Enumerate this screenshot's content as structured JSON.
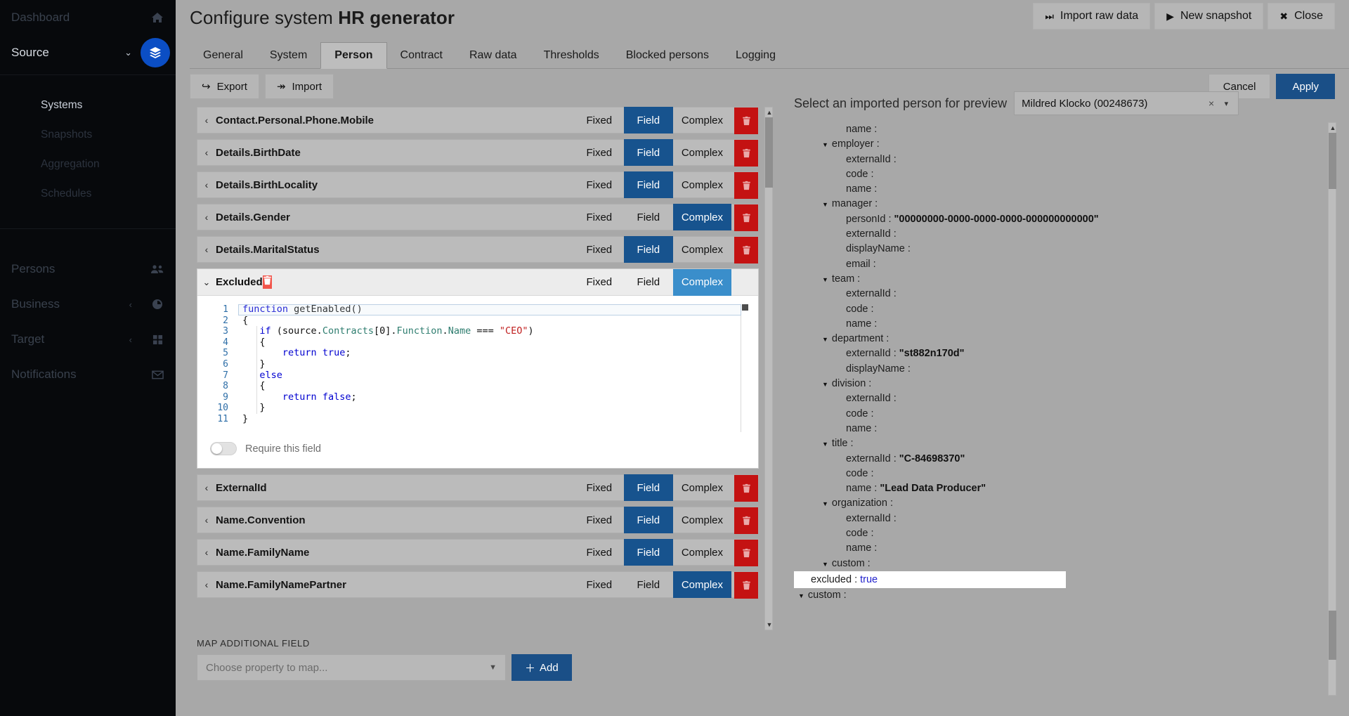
{
  "sidebar": {
    "items": [
      {
        "label": "Dashboard",
        "icon": "home-icon",
        "active": false,
        "chevron": null,
        "highlight": false
      },
      {
        "label": "Source",
        "icon": "layers-icon",
        "active": true,
        "chevron": "⌄",
        "highlight": true
      }
    ],
    "sub_items": [
      {
        "label": "Systems",
        "active": true
      },
      {
        "label": "Snapshots",
        "active": false
      },
      {
        "label": "Aggregation",
        "active": false
      },
      {
        "label": "Schedules",
        "active": false
      }
    ],
    "lower_items": [
      {
        "label": "Persons",
        "icon": "people-icon",
        "chevron": null
      },
      {
        "label": "Business",
        "icon": "pie-chart-icon",
        "chevron": "‹"
      },
      {
        "label": "Target",
        "icon": "grid-icon",
        "chevron": "‹"
      },
      {
        "label": "Notifications",
        "icon": "mail-icon",
        "chevron": null
      }
    ]
  },
  "header": {
    "title_prefix": "Configure system ",
    "title_strong": "HR generator",
    "buttons": [
      {
        "label": "Import raw data",
        "icon": "skip-forward-icon",
        "glyph": "⏭"
      },
      {
        "label": "New snapshot",
        "icon": "play-icon",
        "glyph": "▶"
      },
      {
        "label": "Close",
        "icon": "close-icon",
        "glyph": "✖"
      }
    ]
  },
  "tabs": [
    {
      "label": "General",
      "active": false
    },
    {
      "label": "System",
      "active": false
    },
    {
      "label": "Person",
      "active": true
    },
    {
      "label": "Contract",
      "active": false
    },
    {
      "label": "Raw data",
      "active": false
    },
    {
      "label": "Thresholds",
      "active": false
    },
    {
      "label": "Blocked persons",
      "active": false
    },
    {
      "label": "Logging",
      "active": false
    }
  ],
  "actions": {
    "export_label": "Export",
    "export_glyph": "↪",
    "import_label": "Import",
    "import_glyph": "↠",
    "cancel_label": "Cancel",
    "apply_label": "Apply"
  },
  "segment_labels": {
    "fixed": "Fixed",
    "field": "Field",
    "complex": "Complex"
  },
  "fields": [
    {
      "name": "Contact.Personal.Phone.Mobile",
      "selected": "field",
      "expanded": false
    },
    {
      "name": "Details.BirthDate",
      "selected": "field",
      "expanded": false
    },
    {
      "name": "Details.BirthLocality",
      "selected": "field",
      "expanded": false
    },
    {
      "name": "Details.Gender",
      "selected": "complex",
      "expanded": false
    },
    {
      "name": "Details.MaritalStatus",
      "selected": "field",
      "expanded": false
    },
    {
      "name": "Excluded",
      "selected": "complex",
      "expanded": true
    },
    {
      "name": "ExternalId",
      "selected": "field",
      "expanded": false
    },
    {
      "name": "Name.Convention",
      "selected": "field",
      "expanded": false
    },
    {
      "name": "Name.FamilyName",
      "selected": "field",
      "expanded": false
    },
    {
      "name": "Name.FamilyNamePartner",
      "selected": "complex",
      "expanded": false
    }
  ],
  "editor": {
    "lines": [
      {
        "n": "1",
        "code": "function getEnabled()"
      },
      {
        "n": "2",
        "code": "{"
      },
      {
        "n": "3",
        "code": "    if (source.Contracts[0].Function.Name === \"CEO\")"
      },
      {
        "n": "4",
        "code": "    {"
      },
      {
        "n": "5",
        "code": "        return true;"
      },
      {
        "n": "6",
        "code": "    }"
      },
      {
        "n": "7",
        "code": "    else"
      },
      {
        "n": "8",
        "code": "    {"
      },
      {
        "n": "9",
        "code": "        return false;"
      },
      {
        "n": "10",
        "code": "    }"
      },
      {
        "n": "11",
        "code": "}"
      }
    ],
    "require_label": "Require this field",
    "require_on": false
  },
  "map_additional": {
    "section_label": "MAP ADDITIONAL FIELD",
    "select_placeholder": "Choose property to map...",
    "add_label": "Add",
    "add_glyph": "＋"
  },
  "preview": {
    "select_label": "Select an imported person for preview",
    "selected_person": "Mildred Klocko (00248673)",
    "clear_glyph": "×",
    "caret_glyph": "▾",
    "tree": [
      {
        "indent": 2,
        "expander": false,
        "key": "name",
        "value": ""
      },
      {
        "indent": 1,
        "expander": true,
        "key": "employer",
        "value": ""
      },
      {
        "indent": 2,
        "expander": false,
        "key": "externalId",
        "value": ""
      },
      {
        "indent": 2,
        "expander": false,
        "key": "code",
        "value": ""
      },
      {
        "indent": 2,
        "expander": false,
        "key": "name",
        "value": ""
      },
      {
        "indent": 1,
        "expander": true,
        "key": "manager",
        "value": ""
      },
      {
        "indent": 2,
        "expander": false,
        "key": "personId",
        "value": "\"00000000-0000-0000-0000-000000000000\""
      },
      {
        "indent": 2,
        "expander": false,
        "key": "externalId",
        "value": ""
      },
      {
        "indent": 2,
        "expander": false,
        "key": "displayName",
        "value": ""
      },
      {
        "indent": 2,
        "expander": false,
        "key": "email",
        "value": ""
      },
      {
        "indent": 1,
        "expander": true,
        "key": "team",
        "value": ""
      },
      {
        "indent": 2,
        "expander": false,
        "key": "externalId",
        "value": ""
      },
      {
        "indent": 2,
        "expander": false,
        "key": "code",
        "value": ""
      },
      {
        "indent": 2,
        "expander": false,
        "key": "name",
        "value": ""
      },
      {
        "indent": 1,
        "expander": true,
        "key": "department",
        "value": ""
      },
      {
        "indent": 2,
        "expander": false,
        "key": "externalId",
        "value": "\"st882n170d\""
      },
      {
        "indent": 2,
        "expander": false,
        "key": "displayName",
        "value": ""
      },
      {
        "indent": 1,
        "expander": true,
        "key": "division",
        "value": ""
      },
      {
        "indent": 2,
        "expander": false,
        "key": "externalId",
        "value": ""
      },
      {
        "indent": 2,
        "expander": false,
        "key": "code",
        "value": ""
      },
      {
        "indent": 2,
        "expander": false,
        "key": "name",
        "value": ""
      },
      {
        "indent": 1,
        "expander": true,
        "key": "title",
        "value": ""
      },
      {
        "indent": 2,
        "expander": false,
        "key": "externalId",
        "value": "\"C-84698370\""
      },
      {
        "indent": 2,
        "expander": false,
        "key": "code",
        "value": ""
      },
      {
        "indent": 2,
        "expander": false,
        "key": "name",
        "value": "\"Lead Data Producer\""
      },
      {
        "indent": 1,
        "expander": true,
        "key": "organization",
        "value": ""
      },
      {
        "indent": 2,
        "expander": false,
        "key": "externalId",
        "value": ""
      },
      {
        "indent": 2,
        "expander": false,
        "key": "code",
        "value": ""
      },
      {
        "indent": 2,
        "expander": false,
        "key": "name",
        "value": ""
      },
      {
        "indent": 1,
        "expander": true,
        "key": "custom",
        "value": ""
      },
      {
        "indent": 0,
        "expander": false,
        "key": "excluded",
        "value": "true",
        "highlight": true,
        "boolean": true
      },
      {
        "indent": 0,
        "expander": true,
        "key": "custom",
        "value": ""
      }
    ]
  },
  "colors": {
    "accent_blue": "#1a4f87",
    "segment_blue": "#17538e",
    "light_blue": "#3a8ecb",
    "delete_red": "#c41212",
    "delete_red_light": "#f2554b",
    "sidebar_bg": "#07090c",
    "page_bg": "#a8a8a8"
  }
}
